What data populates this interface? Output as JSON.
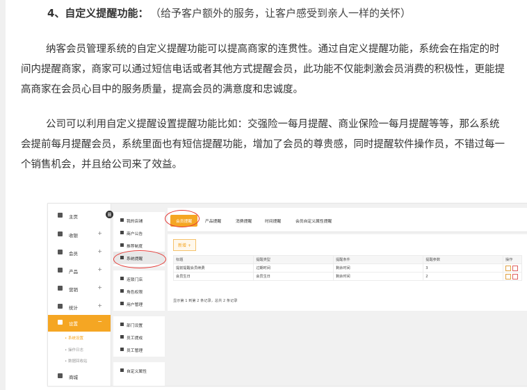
{
  "article": {
    "heading": "4、自定义提醒功能：",
    "heading_note": "（给予客户额外的服务，让客户感受到亲人一样的关怀）",
    "para1": "纳客会员管理系统的自定义提醒功能可以提高商家的连贯性。通过自定义提醒功能，系统会在指定的时间内提醒商家，商家可以通过短信电话或者其他方式提醒会员，此功能不仅能刺激会员消费的积极性，更能提高商家在会员心目中的服务质量，提高会员的满意度和忠诚度。",
    "para2": "公司可以利用自定义提醒设置提醒功能比如：交强险一每月提醒、商业保险一每月提醒等等，那么系统会提前每月提醒会员，系统里面也有短信提醒功能，增加了会员的尊贵感，同时提醒软件操作员，不错过每一个销售机会，并且给公司来了效益。"
  },
  "app": {
    "sidebar": [
      {
        "label": "主页",
        "plus": ""
      },
      {
        "label": "收银",
        "plus": "+"
      },
      {
        "label": "会员",
        "plus": "+"
      },
      {
        "label": "产品",
        "plus": "+"
      },
      {
        "label": "营销",
        "plus": "+"
      },
      {
        "label": "统计",
        "plus": "+"
      },
      {
        "label": "设置",
        "plus": "−"
      },
      {
        "label": "商城",
        "plus": ""
      }
    ],
    "settings_sub": [
      "• 系统设置",
      "• 操作日志",
      "• 数据回收站"
    ],
    "menu_groups": [
      [
        "我的店铺",
        "商户公告",
        "推荐制度",
        "系统提醒"
      ],
      [
        "连锁门店",
        "角色权限",
        "用户管理"
      ],
      [
        "部门设置",
        "员工提成",
        "员工管理"
      ],
      [
        "自定义属性"
      ]
    ],
    "tabs": [
      "会员提醒",
      "产品提醒",
      "消费提醒",
      "时间提醒",
      "会员自定义属性提醒"
    ],
    "add_button": "新增 +",
    "table": {
      "headers": [
        "标题",
        "提醒类型",
        "提醒条件",
        "提醒参数",
        "操作"
      ],
      "rows": [
        [
          "提前提醒会员续费",
          "过期时间",
          "剩余时间",
          "3"
        ],
        [
          "会员生日",
          "会员生日",
          "剩余时间",
          "2"
        ]
      ]
    },
    "pager": "显示第 1 到第 2 条记录，总共 2 条记录"
  }
}
